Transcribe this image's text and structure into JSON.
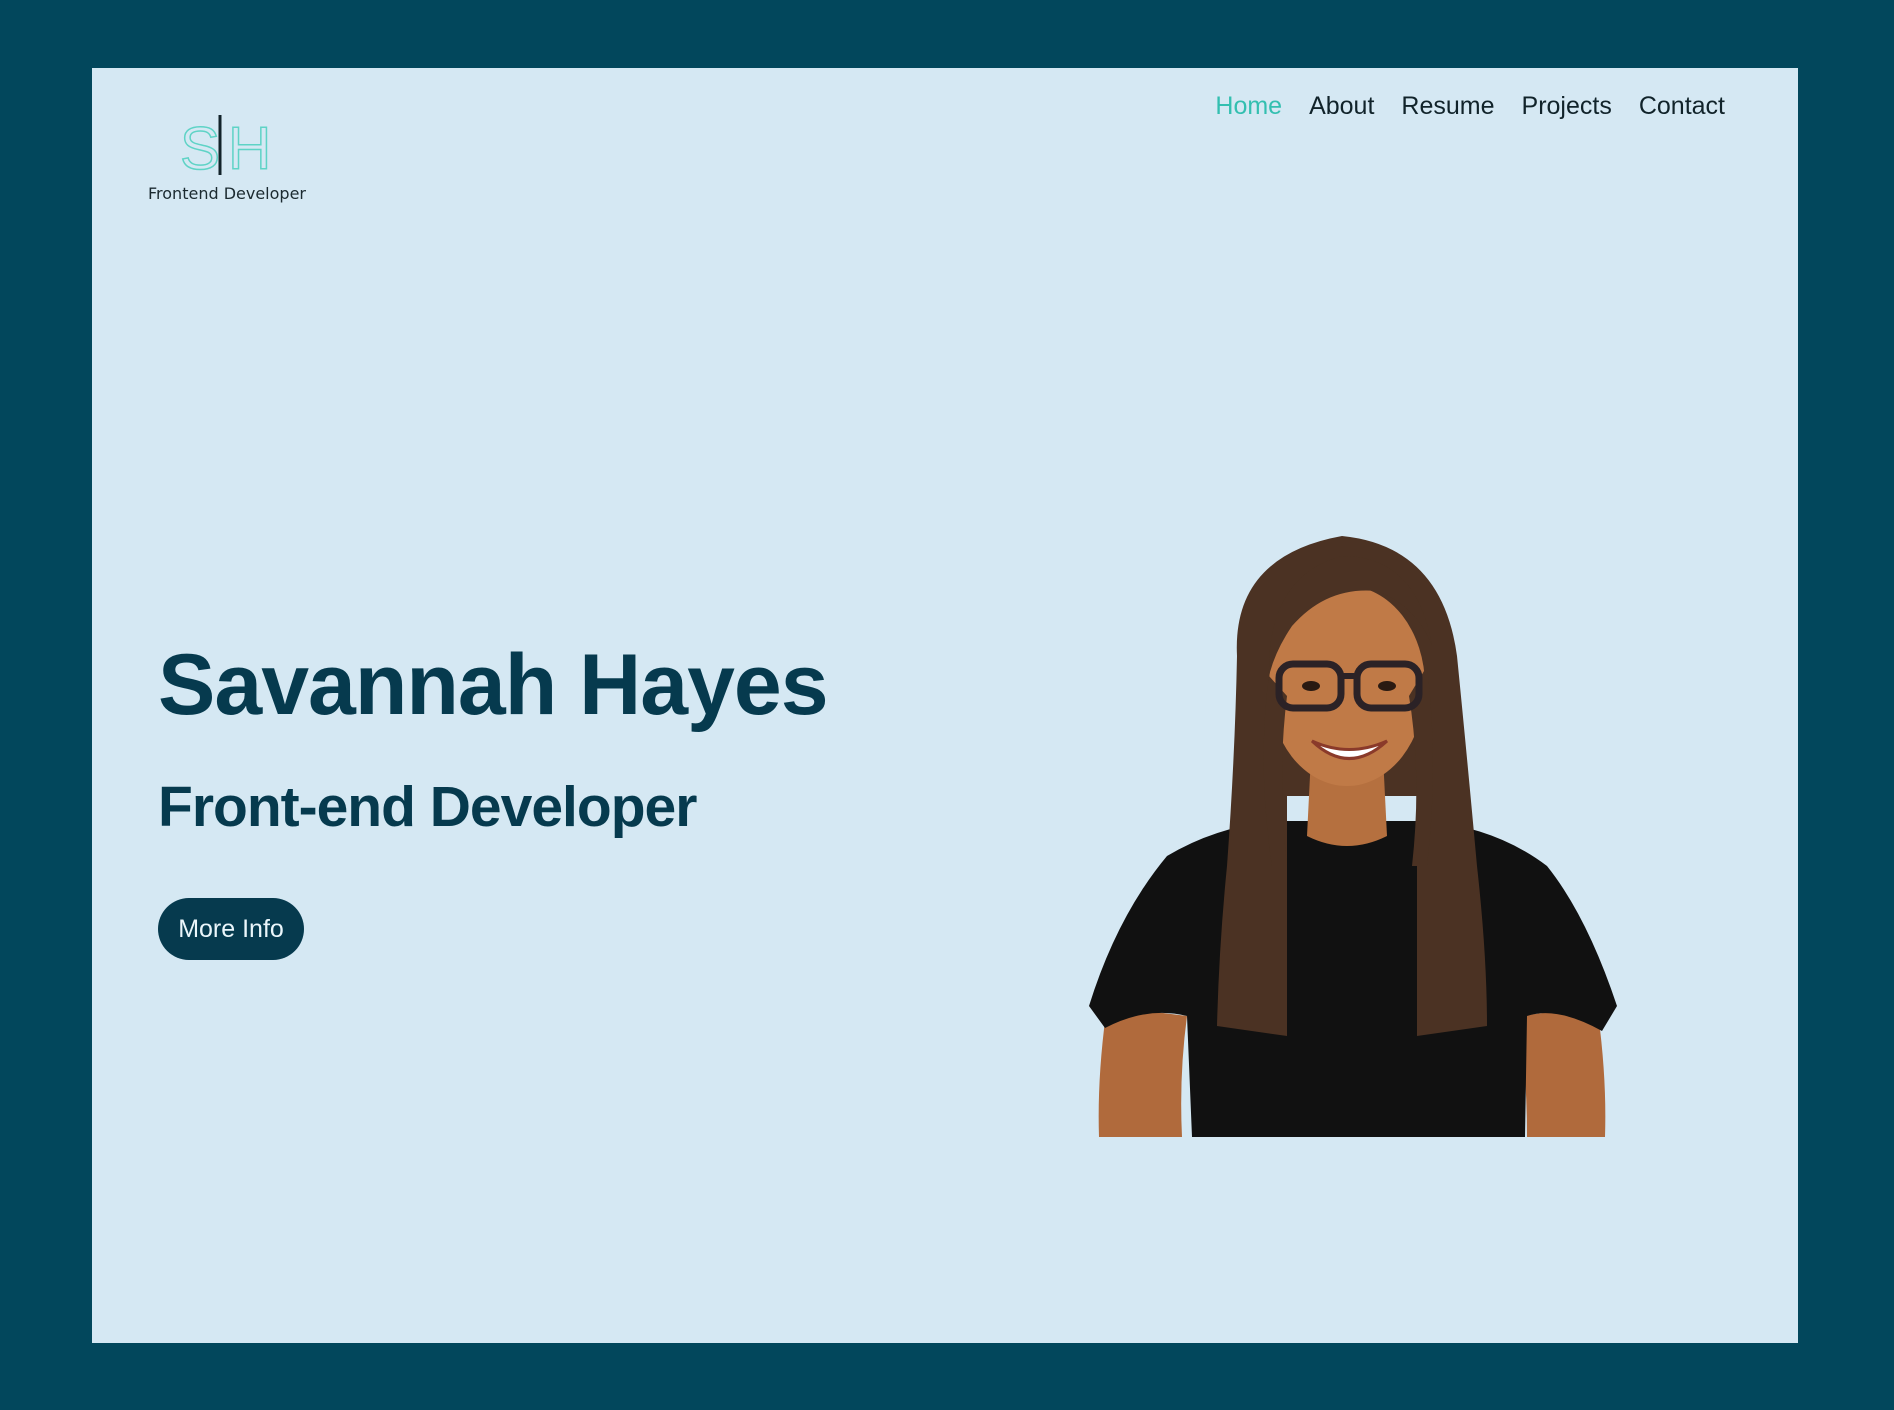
{
  "logo": {
    "initials": "S|H",
    "caption": "Frontend Developer"
  },
  "nav": {
    "items": [
      {
        "label": "Home",
        "active": true
      },
      {
        "label": "About",
        "active": false
      },
      {
        "label": "Resume",
        "active": false
      },
      {
        "label": "Projects",
        "active": false
      },
      {
        "label": "Contact",
        "active": false
      }
    ]
  },
  "hero": {
    "name": "Savannah Hayes",
    "role": "Front-end Developer",
    "button_label": "More Info"
  },
  "colors": {
    "outer_background": "#02475c",
    "page_background": "#d5e8f3",
    "accent": "#33bfb0",
    "heading": "#063a4e"
  },
  "icons": [
    "logo-icon",
    "portrait-photo"
  ]
}
